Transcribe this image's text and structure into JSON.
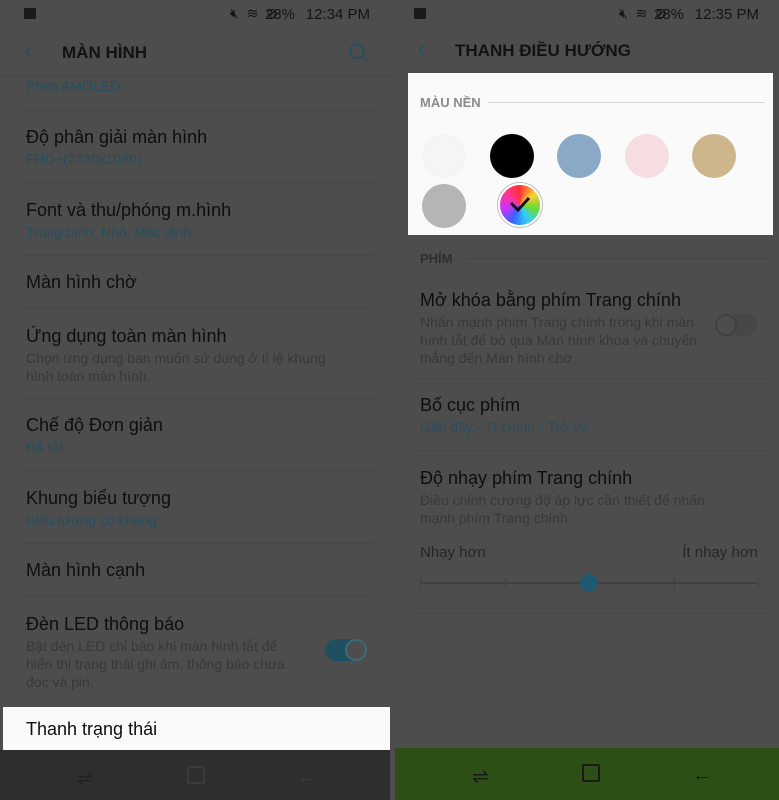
{
  "left": {
    "status": {
      "time": "12:34 PM",
      "battery": "28%",
      "icons": [
        "image-icon",
        "mute-icon",
        "wifi-icon",
        "do-not-disturb-icon",
        "battery-icon"
      ]
    },
    "header": {
      "title": "MÀN HÌNH"
    },
    "items": [
      {
        "subtitle": "Phim AMOLED"
      },
      {
        "title": "Độ phân giải màn hình",
        "subtitle": "FHD+(2220x1080)"
      },
      {
        "title": "Font và thu/phóng m.hình",
        "subtitle": "Trung bình, Nhỏ, Mặc định"
      },
      {
        "title": "Màn hình chờ"
      },
      {
        "title": "Ứng dụng toàn màn hình",
        "desc": "Chọn ứng dụng bạn muốn sử dụng ở tỉ lệ khung hình toàn màn hình."
      },
      {
        "title": "Chế độ Đơn giản",
        "subtitle": "Đã tắt"
      },
      {
        "title": "Khung biểu tượng",
        "subtitle": "Biểu tượng có khung"
      },
      {
        "title": "Màn hình cạnh"
      },
      {
        "title": "Đèn LED thông báo",
        "desc": "Bật đèn LED chỉ báo khi màn hình tắt để hiển thị trạng thái ghi âm, thông báo chưa đọc và pin.",
        "toggle_on": true
      },
      {
        "title": "Thanh trạng thái",
        "highlighted": true
      }
    ],
    "nav_color": "#2e2e2e"
  },
  "right": {
    "status": {
      "time": "12:35 PM",
      "battery": "28%"
    },
    "header": {
      "title": "THANH ĐIỀU HƯỚNG"
    },
    "bg_section": {
      "label": "MÀU NỀN",
      "colors": [
        "#f5f5f5",
        "#000000",
        "#8aa9c6",
        "#f6dde2",
        "#cdb68b",
        "#b5b5b5"
      ],
      "custom_selected": true
    },
    "keys_section": {
      "label": "PHÍM"
    },
    "unlock": {
      "title": "Mở khóa bằng phím Trang chính",
      "desc": "Nhấn mạnh phím Trang chính trong khi màn hình tắt để bỏ qua Màn hình khóa và chuyển thẳng đến Màn hình chờ.",
      "toggle_on": false
    },
    "layout": {
      "title": "Bố cục phím",
      "subtitle": "Gần đây - Tr.chính - Trở về"
    },
    "sensitivity": {
      "title": "Độ nhạy phím Trang chính",
      "desc": "Điều chỉnh cường độ áp lực cần thiết để nhấn mạnh phím Trang chính.",
      "min_label": "Nhạy hơn",
      "max_label": "Ít nhạy hơn",
      "steps": 5,
      "value": 2
    },
    "nav_color": "#2d4f15"
  },
  "nav_icons": [
    "recents-icon",
    "home-icon",
    "back-icon"
  ]
}
